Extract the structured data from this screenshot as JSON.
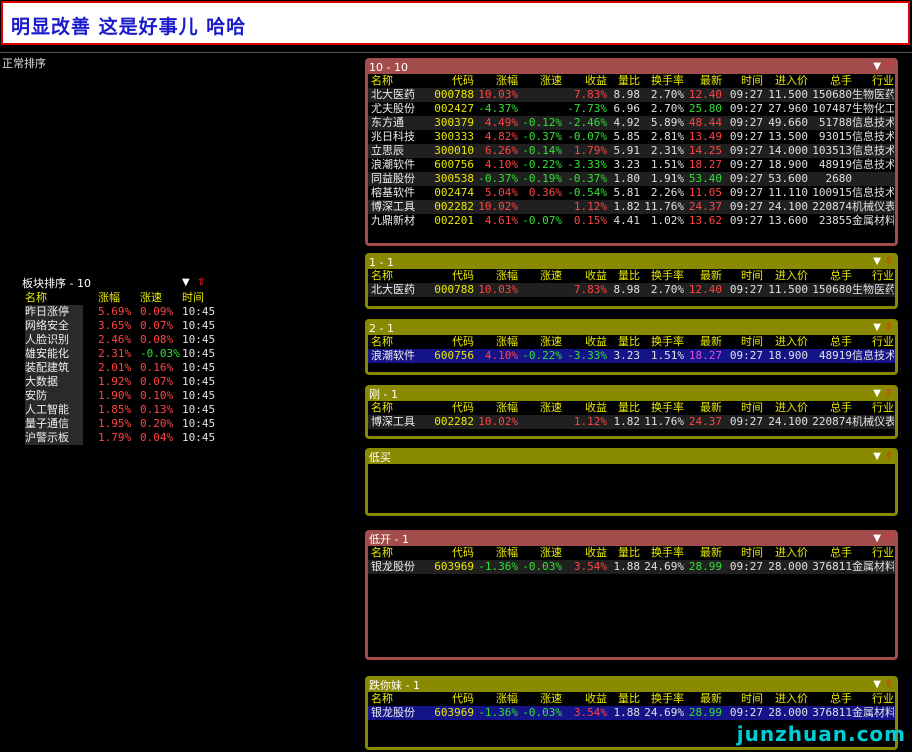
{
  "banner": {
    "title": "明显改善 这是好事儿 哈哈"
  },
  "sort_label": "正常排序",
  "columns": [
    "名称",
    "代码",
    "涨幅",
    "涨速",
    "收益",
    "量比",
    "换手率",
    "最新",
    "时间",
    "进入价",
    "总手",
    "行业"
  ],
  "sector_panel": {
    "title": "板块排序 - 10",
    "columns": [
      "名称",
      "涨幅",
      "涨速",
      "时间"
    ],
    "rows": [
      {
        "name": "昨日涨停",
        "chg": "5.69%",
        "speed": "0.09%",
        "time": "10:45",
        "speed_color": "red"
      },
      {
        "name": "网络安全",
        "chg": "3.65%",
        "speed": "0.07%",
        "time": "10:45",
        "speed_color": "red"
      },
      {
        "name": "人脸识别",
        "chg": "2.46%",
        "speed": "0.08%",
        "time": "10:45",
        "speed_color": "red"
      },
      {
        "name": "雄安能化",
        "chg": "2.31%",
        "speed": "-0.03%",
        "time": "10:45",
        "speed_color": "green"
      },
      {
        "name": "装配建筑",
        "chg": "2.01%",
        "speed": "0.16%",
        "time": "10:45",
        "speed_color": "red"
      },
      {
        "name": "大数据",
        "chg": "1.92%",
        "speed": "0.07%",
        "time": "10:45",
        "speed_color": "red"
      },
      {
        "name": "安防",
        "chg": "1.90%",
        "speed": "0.10%",
        "time": "10:45",
        "speed_color": "red"
      },
      {
        "name": "人工智能",
        "chg": "1.85%",
        "speed": "0.13%",
        "time": "10:45",
        "speed_color": "red"
      },
      {
        "name": "量子通信",
        "chg": "1.95%",
        "speed": "0.20%",
        "time": "10:45",
        "speed_color": "red"
      },
      {
        "name": "沪警示板",
        "chg": "1.79%",
        "speed": "0.04%",
        "time": "10:45",
        "speed_color": "red"
      }
    ]
  },
  "panels": [
    {
      "id": "panel-10-10",
      "title": "10 - 10",
      "style": "red",
      "rows": [
        {
          "name": "北大医药",
          "code": "000788",
          "chg": "10.03%",
          "speed": "",
          "ret": "7.83%",
          "vr": "8.98",
          "tr": "2.70%",
          "last": "12.40",
          "time": "09:27",
          "entry": "11.500",
          "total": "150680",
          "industry": "生物医药",
          "chg_c": "red",
          "speed_c": "",
          "ret_c": "red",
          "last_c": "red"
        },
        {
          "name": "尤夫股份",
          "code": "002427",
          "chg": "-4.37%",
          "speed": "",
          "ret": "-7.73%",
          "vr": "6.96",
          "tr": "2.70%",
          "last": "25.80",
          "time": "09:27",
          "entry": "27.960",
          "total": "107487",
          "industry": "生物化工",
          "chg_c": "green",
          "speed_c": "",
          "ret_c": "green",
          "last_c": "green"
        },
        {
          "name": "东方通",
          "code": "300379",
          "chg": "4.49%",
          "speed": "-0.12%",
          "ret": "-2.46%",
          "vr": "4.92",
          "tr": "5.89%",
          "last": "48.44",
          "time": "09:27",
          "entry": "49.660",
          "total": "51788",
          "industry": "信息技术",
          "chg_c": "red",
          "speed_c": "green",
          "ret_c": "green",
          "last_c": "red"
        },
        {
          "name": "兆日科技",
          "code": "300333",
          "chg": "4.82%",
          "speed": "-0.37%",
          "ret": "-0.07%",
          "vr": "5.85",
          "tr": "2.81%",
          "last": "13.49",
          "time": "09:27",
          "entry": "13.500",
          "total": "93015",
          "industry": "信息技术",
          "chg_c": "red",
          "speed_c": "green",
          "ret_c": "green",
          "last_c": "red"
        },
        {
          "name": "立思辰",
          "code": "300010",
          "chg": "6.26%",
          "speed": "-0.14%",
          "ret": "1.79%",
          "vr": "5.91",
          "tr": "2.31%",
          "last": "14.25",
          "time": "09:27",
          "entry": "14.000",
          "total": "103513",
          "industry": "信息技术",
          "chg_c": "red",
          "speed_c": "green",
          "ret_c": "red",
          "last_c": "red"
        },
        {
          "name": "浪潮软件",
          "code": "600756",
          "chg": "4.10%",
          "speed": "-0.22%",
          "ret": "-3.33%",
          "vr": "3.23",
          "tr": "1.51%",
          "last": "18.27",
          "time": "09:27",
          "entry": "18.900",
          "total": "48919",
          "industry": "信息技术",
          "chg_c": "red",
          "speed_c": "green",
          "ret_c": "green",
          "last_c": "red"
        },
        {
          "name": "同益股份",
          "code": "300538",
          "chg": "-0.37%",
          "speed": "-0.19%",
          "ret": "-0.37%",
          "vr": "1.80",
          "tr": "1.91%",
          "last": "53.40",
          "time": "09:27",
          "entry": "53.600",
          "total": "2680",
          "industry": "",
          "chg_c": "green",
          "speed_c": "green",
          "ret_c": "green",
          "last_c": "green"
        },
        {
          "name": "榕基软件",
          "code": "002474",
          "chg": "5.04%",
          "speed": "0.36%",
          "ret": "-0.54%",
          "vr": "5.81",
          "tr": "2.26%",
          "last": "11.05",
          "time": "09:27",
          "entry": "11.110",
          "total": "100915",
          "industry": "信息技术",
          "chg_c": "red",
          "speed_c": "red",
          "ret_c": "green",
          "last_c": "red"
        },
        {
          "name": "博深工具",
          "code": "002282",
          "chg": "10.02%",
          "speed": "",
          "ret": "1.12%",
          "vr": "1.82",
          "tr": "11.76%",
          "last": "24.37",
          "time": "09:27",
          "entry": "24.100",
          "total": "220874",
          "industry": "机械仪表",
          "chg_c": "red",
          "speed_c": "",
          "ret_c": "red",
          "last_c": "red"
        },
        {
          "name": "九鼎新材",
          "code": "002201",
          "chg": "4.61%",
          "speed": "-0.07%",
          "ret": "0.15%",
          "vr": "4.41",
          "tr": "1.02%",
          "last": "13.62",
          "time": "09:27",
          "entry": "13.600",
          "total": "23855",
          "industry": "金属材料",
          "chg_c": "red",
          "speed_c": "green",
          "ret_c": "red",
          "last_c": "red"
        }
      ]
    },
    {
      "id": "panel-1-1",
      "title": "1 - 1",
      "style": "olive",
      "rows": [
        {
          "name": "北大医药",
          "code": "000788",
          "chg": "10.03%",
          "speed": "",
          "ret": "7.83%",
          "vr": "8.98",
          "tr": "2.70%",
          "last": "12.40",
          "time": "09:27",
          "entry": "11.500",
          "total": "150680",
          "industry": "生物医药",
          "chg_c": "red",
          "speed_c": "",
          "ret_c": "red",
          "last_c": "red"
        }
      ]
    },
    {
      "id": "panel-2-1",
      "title": "2 - 1",
      "style": "olive",
      "selected": true,
      "rows": [
        {
          "name": "浪潮软件",
          "code": "600756",
          "chg": "4.10%",
          "speed": "-0.22%",
          "ret": "-3.33%",
          "vr": "3.23",
          "tr": "1.51%",
          "last": "18.27",
          "time": "09:27",
          "entry": "18.900",
          "total": "48919",
          "industry": "信息技术",
          "chg_c": "red",
          "speed_c": "green",
          "ret_c": "green",
          "last_c": "mag"
        }
      ]
    },
    {
      "id": "panel-gang-1",
      "title": "刚 - 1",
      "style": "olive",
      "rows": [
        {
          "name": "博深工具",
          "code": "002282",
          "chg": "10.02%",
          "speed": "",
          "ret": "1.12%",
          "vr": "1.82",
          "tr": "11.76%",
          "last": "24.37",
          "time": "09:27",
          "entry": "24.100",
          "total": "220874",
          "industry": "机械仪表",
          "chg_c": "red",
          "speed_c": "",
          "ret_c": "red",
          "last_c": "red"
        }
      ]
    },
    {
      "id": "panel-dimai",
      "title": "低买",
      "style": "olive",
      "no_header": true,
      "rows": []
    },
    {
      "id": "panel-dikai-1",
      "title": "低开 - 1",
      "style": "red",
      "rows": [
        {
          "name": "银龙股份",
          "code": "603969",
          "chg": "-1.36%",
          "speed": "-0.03%",
          "ret": "3.54%",
          "vr": "1.88",
          "tr": "24.69%",
          "last": "28.99",
          "time": "09:27",
          "entry": "28.000",
          "total": "376811",
          "industry": "金属材料",
          "chg_c": "green",
          "speed_c": "green",
          "ret_c": "red",
          "last_c": "green"
        }
      ]
    },
    {
      "id": "panel-dienimei-1",
      "title": "跌你妹 - 1",
      "style": "olive",
      "selected": true,
      "rows": [
        {
          "name": "银龙股份",
          "code": "603969",
          "chg": "-1.36%",
          "speed": "-0.03%",
          "ret": "3.54%",
          "vr": "1.88",
          "tr": "24.69%",
          "last": "28.99",
          "time": "09:27",
          "entry": "28.000",
          "total": "376811",
          "industry": "金属材料",
          "chg_c": "green",
          "speed_c": "green",
          "ret_c": "red",
          "last_c": "green"
        }
      ]
    }
  ],
  "watermark": "junzhuan.com",
  "icons": {
    "menu": "menu-triangle-icon",
    "collapse": "red-up-arrow-icon"
  },
  "colors": {
    "up": "#ff4545",
    "down": "#33e033",
    "selected_row": "#141488",
    "panel_red": "#a24c4c",
    "panel_olive": "#8a8a00"
  }
}
